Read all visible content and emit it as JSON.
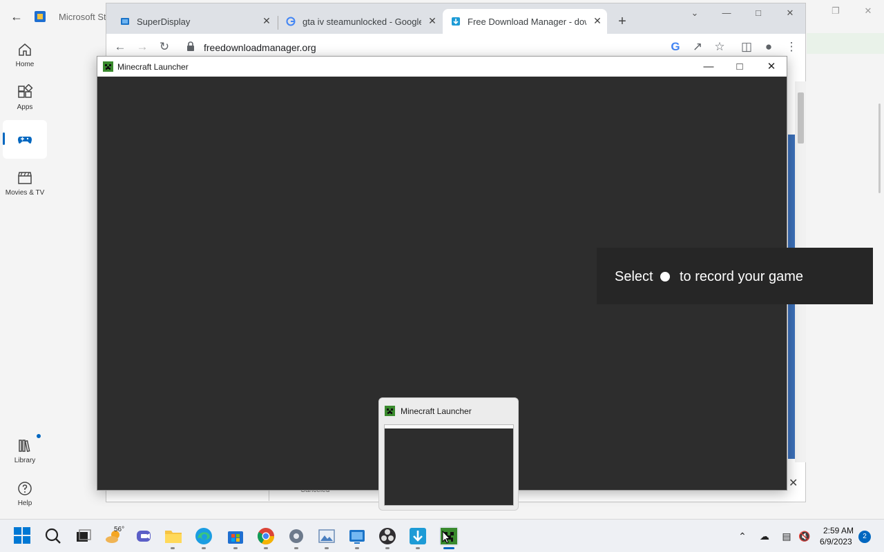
{
  "store": {
    "title": "Microsoft Sto",
    "nav": {
      "home": "Home",
      "apps": "Apps",
      "gaming": "",
      "movies": "Movies & TV",
      "library": "Library",
      "help": "Help"
    }
  },
  "browser": {
    "tabs": [
      {
        "title": "SuperDisplay",
        "icon": "superdisplay-icon"
      },
      {
        "title": "gta iv steamunlocked - Google S",
        "icon": "google-icon"
      },
      {
        "title": "Free Download Manager - down",
        "icon": "fdm-icon"
      }
    ],
    "url": "freedownloadmanager.org",
    "page": {
      "canceled_label": "Canceled"
    }
  },
  "minecraft_window": {
    "title": "Minecraft Launcher"
  },
  "toast": {
    "prefix": "Select",
    "suffix": "to record your game"
  },
  "thumbnail": {
    "title": "Minecraft Launcher"
  },
  "taskbar": {
    "weather_temp": "56°",
    "apps": [
      "start",
      "search",
      "task-view",
      "weather",
      "teams",
      "file-explorer",
      "edge",
      "microsoft-store",
      "chrome",
      "settings",
      "photos",
      "superdisplay",
      "obs",
      "free-download-manager",
      "minecraft-launcher"
    ],
    "clock": {
      "time": "2:59 AM",
      "date": "6/9/2023"
    },
    "notifications": "2"
  },
  "colors": {
    "accent": "#0067c0",
    "minecraft_bg": "#2d2d2d",
    "toast_bg": "#262626"
  }
}
